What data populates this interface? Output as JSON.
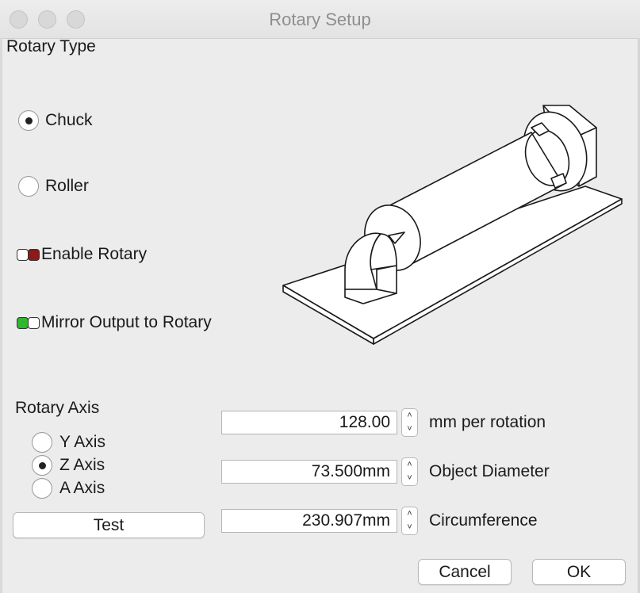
{
  "window": {
    "title": "Rotary Setup"
  },
  "rotary_type": {
    "heading": "Rotary Type",
    "options": [
      {
        "label": "Chuck",
        "selected": true
      },
      {
        "label": "Roller",
        "selected": false
      }
    ]
  },
  "toggles": {
    "enable_rotary": {
      "label": "Enable Rotary",
      "on": false,
      "color": "#8b1a1a"
    },
    "mirror_output": {
      "label": "Mirror Output to Rotary",
      "on": true,
      "color": "#2db82d"
    }
  },
  "rotary_axis": {
    "heading": "Rotary Axis",
    "options": [
      {
        "label": "Y Axis",
        "selected": false
      },
      {
        "label": "Z Axis",
        "selected": true
      },
      {
        "label": "A Axis",
        "selected": false
      }
    ]
  },
  "fields": {
    "mm_per_rotation": {
      "value": "128.00",
      "label": "mm per rotation"
    },
    "object_diameter": {
      "value": "73.500mm",
      "label": "Object Diameter"
    },
    "circumference": {
      "value": "230.907mm",
      "label": "Circumference"
    }
  },
  "buttons": {
    "test": "Test",
    "cancel": "Cancel",
    "ok": "OK"
  }
}
